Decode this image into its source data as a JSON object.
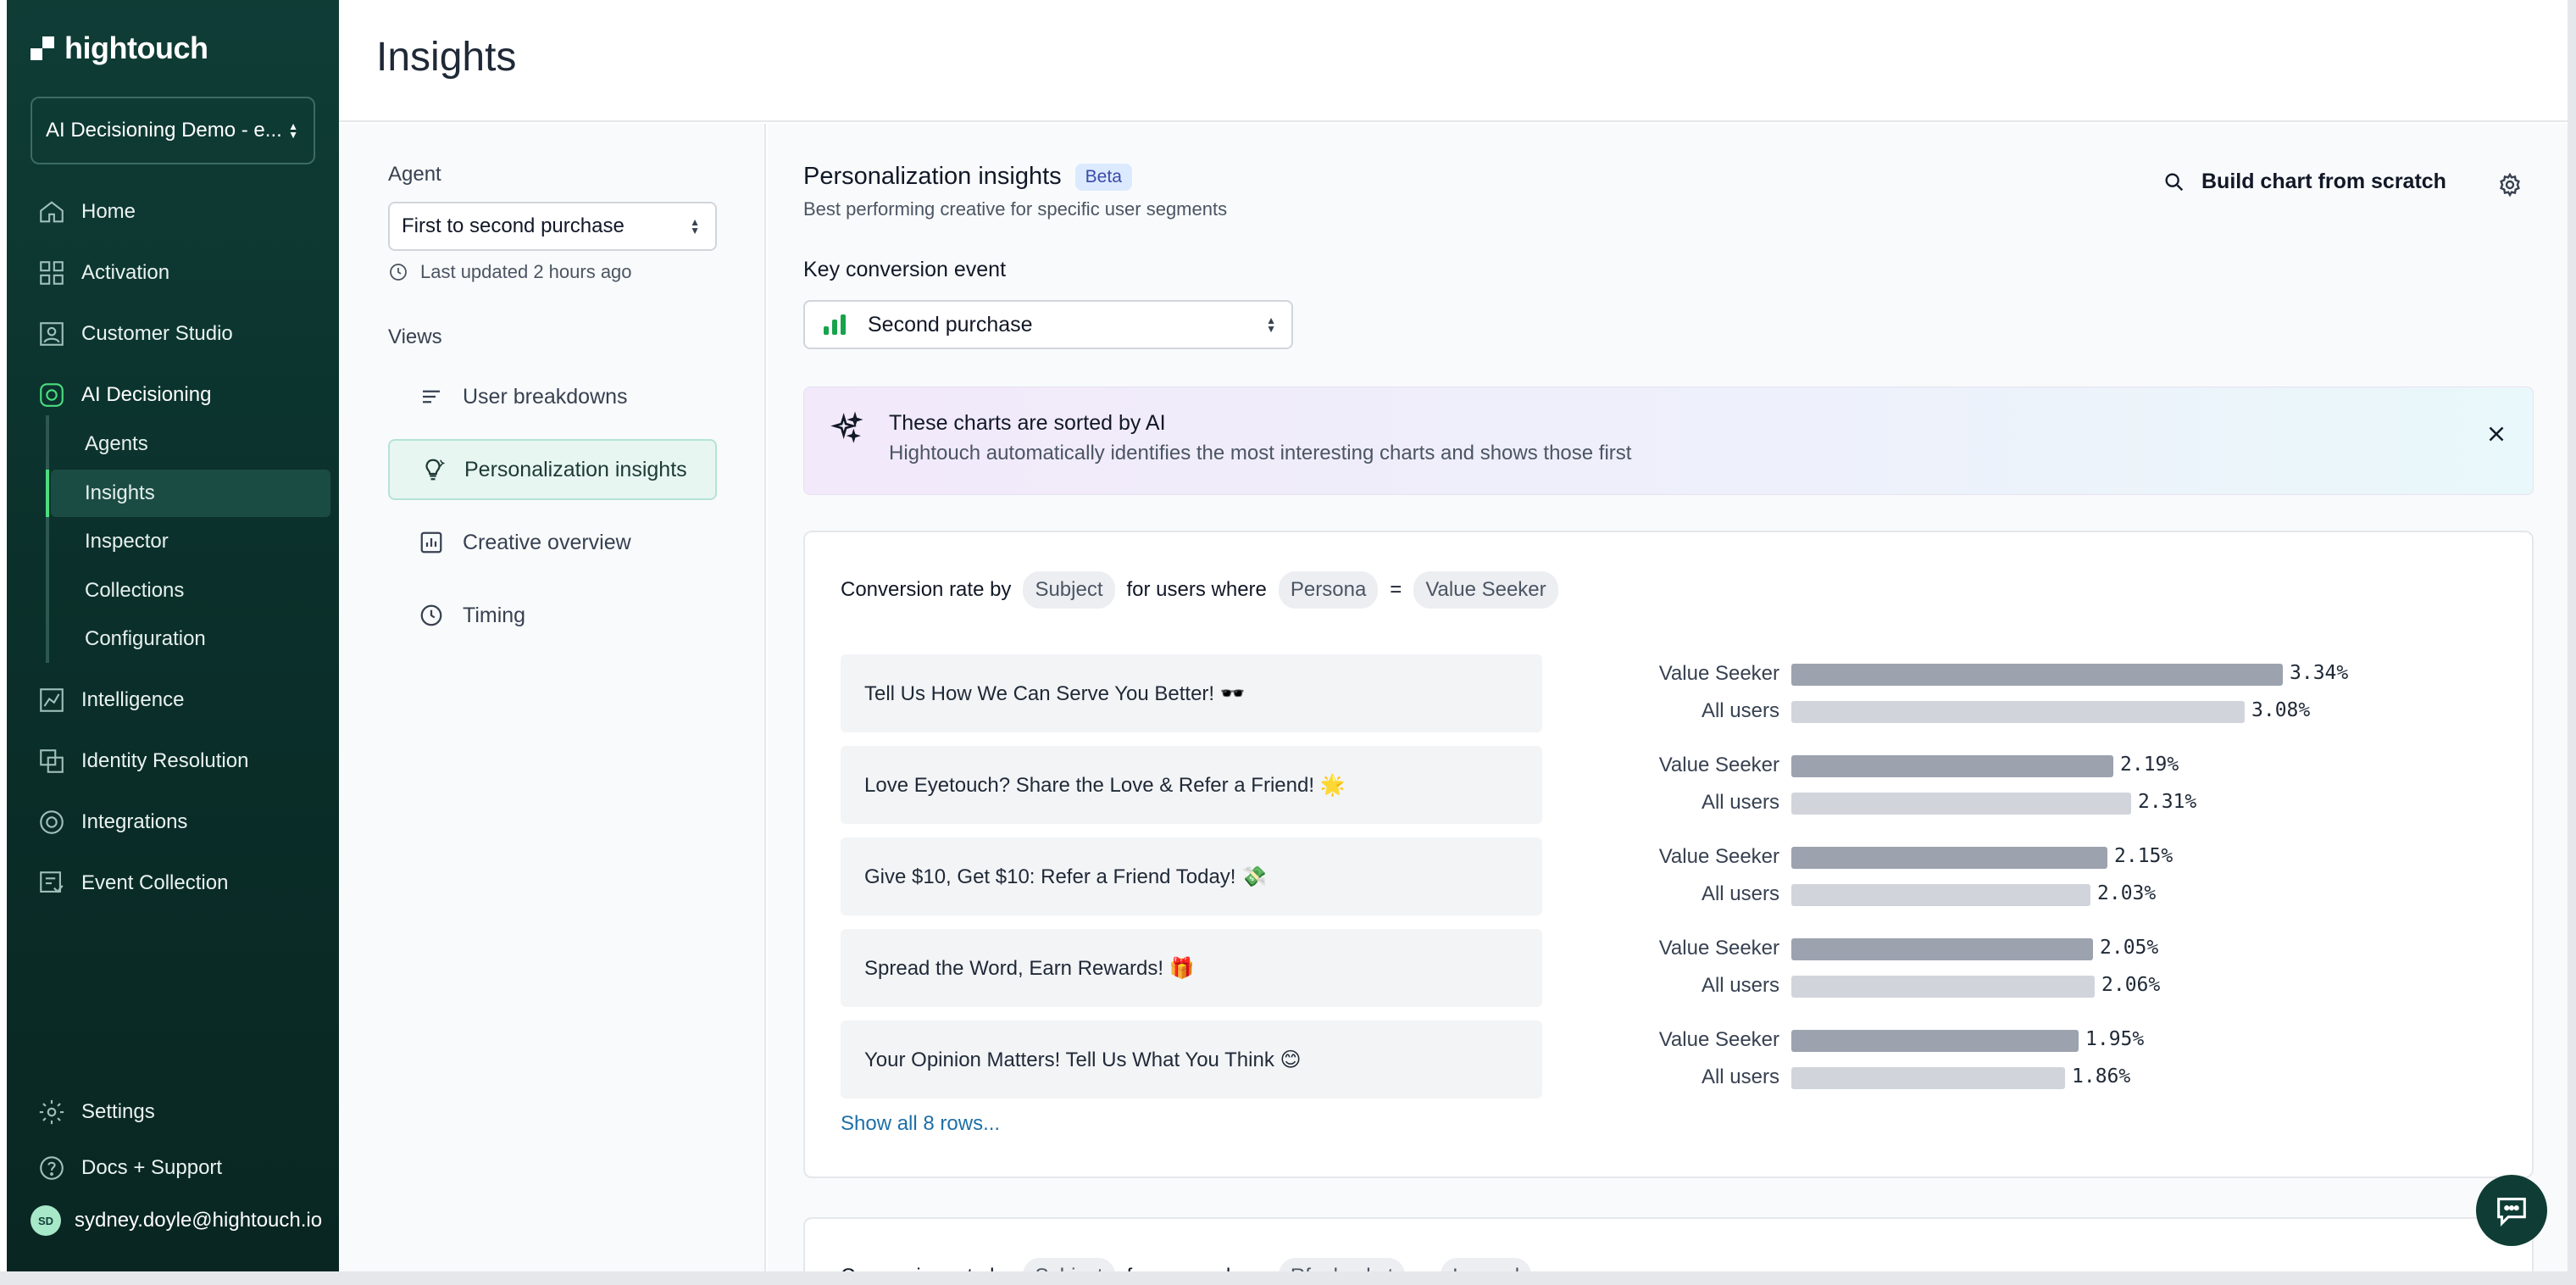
{
  "app": {
    "logo_text": "hightouch"
  },
  "sidebar": {
    "workspace": "AI Decisioning Demo - e...",
    "nav": [
      {
        "label": "Home",
        "icon": "home-icon"
      },
      {
        "label": "Activation",
        "icon": "activation-icon"
      },
      {
        "label": "Customer Studio",
        "icon": "customer-studio-icon"
      },
      {
        "label": "AI Decisioning",
        "icon": "ai-decisioning-icon",
        "active": true
      }
    ],
    "subnav": [
      "Agents",
      "Insights",
      "Inspector",
      "Collections",
      "Configuration"
    ],
    "subnav_active": "Insights",
    "nav2": [
      {
        "label": "Intelligence",
        "icon": "intelligence-icon"
      },
      {
        "label": "Identity Resolution",
        "icon": "identity-resolution-icon"
      },
      {
        "label": "Integrations",
        "icon": "integrations-icon"
      },
      {
        "label": "Event Collection",
        "icon": "event-collection-icon"
      }
    ],
    "bottom": [
      {
        "label": "Settings",
        "icon": "settings-icon"
      },
      {
        "label": "Docs + Support",
        "icon": "help-icon"
      }
    ],
    "user": {
      "initials": "SD",
      "email": "sydney.doyle@hightouch.io"
    }
  },
  "header": {
    "title": "Insights"
  },
  "left_panel": {
    "agent_label": "Agent",
    "agent_value": "First to second purchase",
    "last_updated": "Last updated 2 hours ago",
    "views_label": "Views",
    "views": [
      {
        "label": "User breakdowns",
        "icon": "list-icon"
      },
      {
        "label": "Personalization insights",
        "icon": "lightbulb-icon",
        "active": true
      },
      {
        "label": "Creative overview",
        "icon": "chart-icon"
      },
      {
        "label": "Timing",
        "icon": "clock-icon"
      }
    ]
  },
  "main": {
    "title": "Personalization insights",
    "badge": "Beta",
    "subtitle": "Best performing creative for specific user segments",
    "build_button": "Build chart from scratch",
    "key_event_label": "Key conversion event",
    "key_event_value": "Second purchase",
    "banner": {
      "title": "These charts are sorted by AI",
      "text": "Hightouch automatically identifies the most interesting charts and shows those first"
    },
    "card1": {
      "prefix": "Conversion rate by",
      "dimension": "Subject",
      "middle": "for users where",
      "filter_key": "Persona",
      "operator": "=",
      "filter_value": "Value Seeker",
      "show_all": "Show all 8 rows...",
      "segment_label": "Value Seeker",
      "all_label": "All users"
    },
    "card2": {
      "prefix": "Conversion rate by",
      "dimension": "Subject",
      "middle": "for users where",
      "filter_key": "Rfm bucket",
      "operator": "=",
      "filter_value": "Lapsed"
    }
  },
  "chart_data": {
    "type": "bar",
    "categories": [
      "Tell Us How We Can Serve You Better! 🕶️",
      "Love Eyetouch? Share the Love & Refer a Friend! 🌟",
      "Give $10, Get $10: Refer a Friend Today! 💸",
      "Spread the Word, Earn Rewards! 🎁",
      "Your Opinion Matters! Tell Us What You Think 😊"
    ],
    "series": [
      {
        "name": "Value Seeker",
        "values": [
          3.34,
          2.19,
          2.15,
          2.05,
          1.95
        ],
        "labels": [
          "3.34%",
          "2.19%",
          "2.15%",
          "2.05%",
          "1.95%"
        ],
        "color": "#9ca3af"
      },
      {
        "name": "All users",
        "values": [
          3.08,
          2.31,
          2.03,
          2.06,
          1.86
        ],
        "labels": [
          "3.08%",
          "2.31%",
          "2.03%",
          "2.06%",
          "1.86%"
        ],
        "color": "#d1d5db"
      }
    ],
    "xlim": [
      0,
      3.34
    ]
  }
}
